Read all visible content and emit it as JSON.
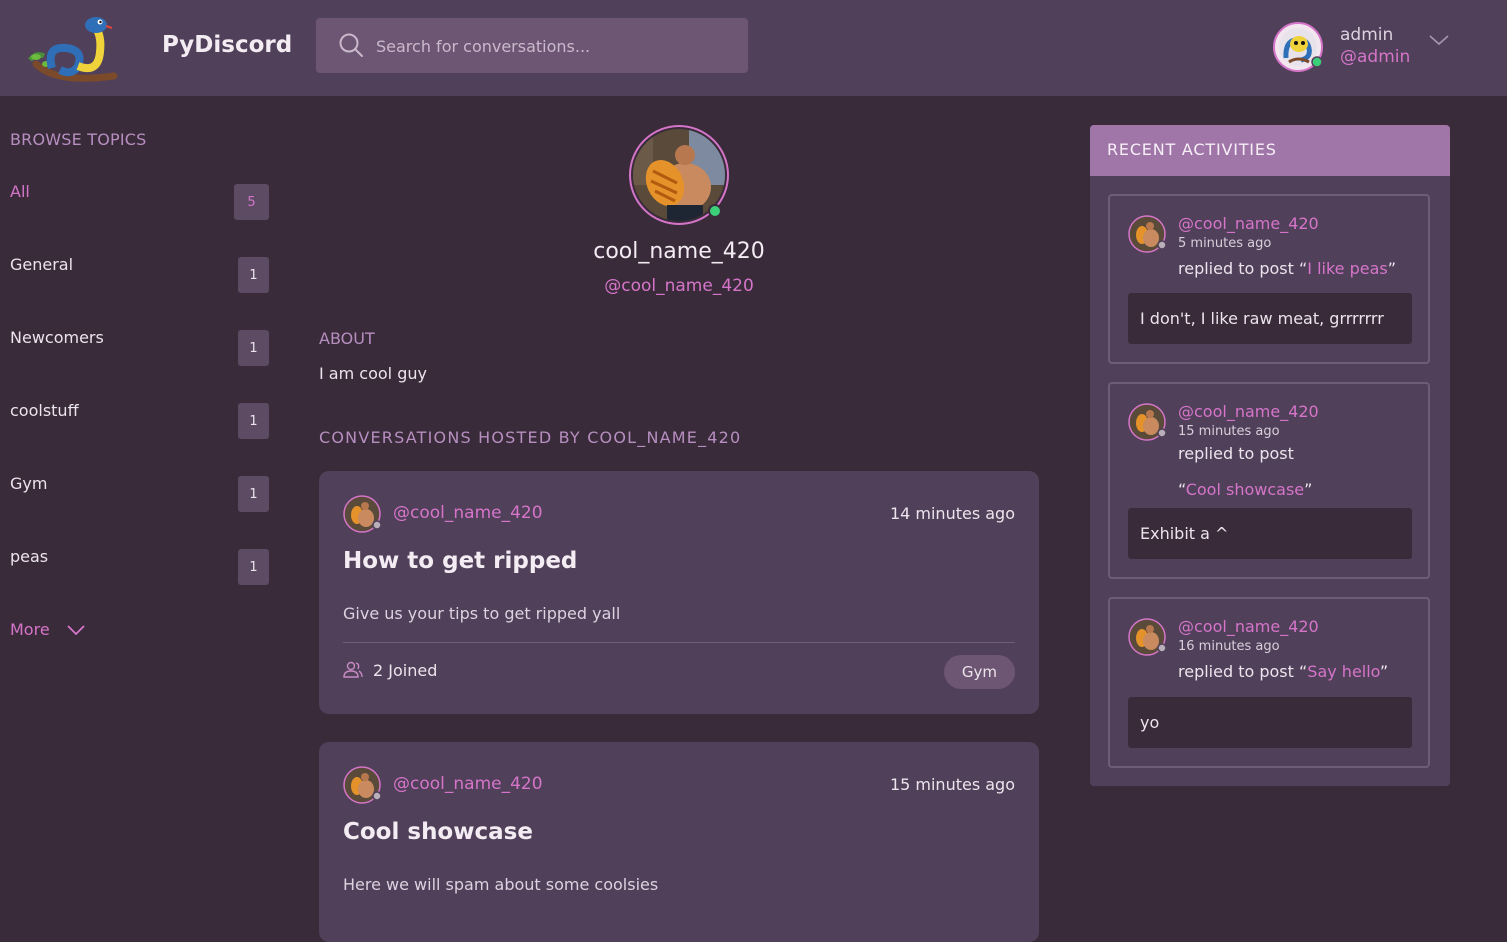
{
  "header": {
    "brand": "PyDiscord",
    "search_placeholder": "Search for conversations...",
    "user": {
      "name": "admin",
      "handle": "@admin"
    }
  },
  "sidebar": {
    "title": "BROWSE TOPICS",
    "topics": [
      {
        "name": "All",
        "count": "5"
      },
      {
        "name": "General",
        "count": "1"
      },
      {
        "name": "Newcomers",
        "count": "1"
      },
      {
        "name": "coolstuff",
        "count": "1"
      },
      {
        "name": "Gym",
        "count": "1"
      },
      {
        "name": "peas",
        "count": "1"
      }
    ],
    "more_label": "More"
  },
  "profile": {
    "name": "cool_name_420",
    "handle": "@cool_name_420",
    "about_label": "ABOUT",
    "about_text": "I am cool guy",
    "conversations_label": "CONVERSATIONS HOSTED BY COOL_NAME_420"
  },
  "conversations": [
    {
      "handle": "@cool_name_420",
      "time": "14 minutes ago",
      "title": "How to get ripped",
      "description": "Give us your tips to get ripped yall",
      "joined": "2 Joined",
      "tag": "Gym"
    },
    {
      "handle": "@cool_name_420",
      "time": "15 minutes ago",
      "title": "Cool showcase",
      "description": "Here we will spam about some coolsies"
    }
  ],
  "activities": {
    "title": "RECENT ACTIVITIES",
    "items": [
      {
        "handle": "@cool_name_420",
        "time": "5 minutes ago",
        "action": "replied to post “",
        "post": "I like peas",
        "close": "”",
        "body": "I don't, I like raw meat, grrrrrrr"
      },
      {
        "handle": "@cool_name_420",
        "time": "15 minutes ago",
        "action": "replied to post “",
        "post": "Cool showcase",
        "close": "”",
        "body": "Exhibit a ^"
      },
      {
        "handle": "@cool_name_420",
        "time": "16 minutes ago",
        "action": "replied to post “",
        "post": "Say hello",
        "close": "”",
        "body": "yo"
      }
    ]
  },
  "colors": {
    "background": "#3a2b3a",
    "header": "#51405a",
    "accent": "#d575c9",
    "activity_header": "#a076a9",
    "online": "#3ccf7a",
    "offline": "#b9b0ba"
  }
}
